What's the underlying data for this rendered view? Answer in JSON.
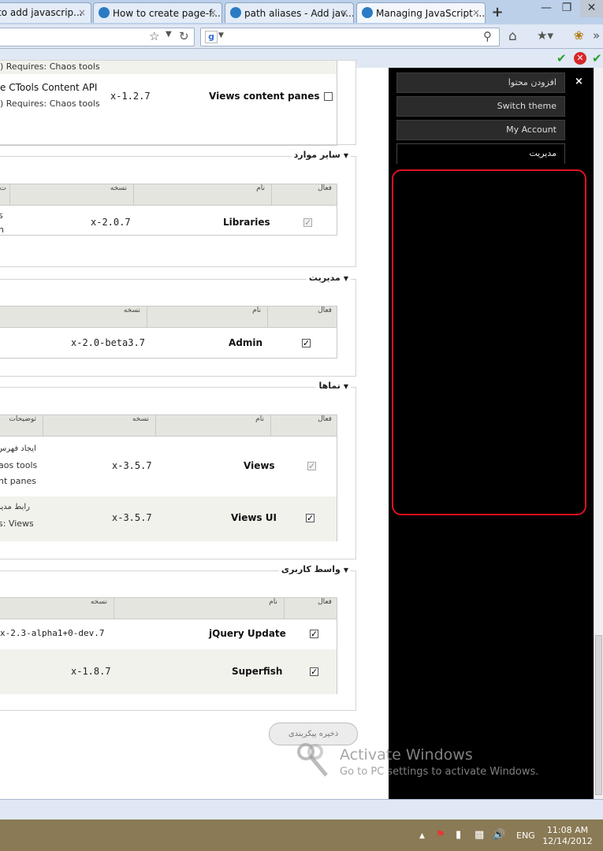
{
  "browser": {
    "tabs": [
      {
        "title": "to add javascrip..."
      },
      {
        "title": "How to create page-f..."
      },
      {
        "title": "path aliases - Add jav..."
      },
      {
        "title": "Managing JavaScript ..."
      }
    ],
    "tab_close": "×",
    "new_tab": "+"
  },
  "page": {
    "top_row": {
      "desc_line1": ") Requires: Chaos tools",
      "desc_line2_a": "e CTools Content API",
      "desc_line3": ") Requires: Chaos tools",
      "version": "x-1.2.7",
      "name": "Views content panes"
    },
    "groups": [
      {
        "legend": "سایر موارد",
        "headers": {
          "enabled": "فعال",
          "name": "نام",
          "version": "نسخه",
          "desc": "ت"
        },
        "rows": [
          {
            "name": "Libraries",
            "version": "x-2.0.7",
            "desc1": "s",
            "desc2": "n"
          }
        ]
      },
      {
        "legend": "مدیریت",
        "headers": {
          "enabled": "فعال",
          "name": "نام",
          "version": "نسخه"
        },
        "rows": [
          {
            "name": "Admin",
            "version": "x-2.0-beta3.7"
          }
        ]
      },
      {
        "legend": "نماها",
        "headers": {
          "enabled": "فعال",
          "name": "نام",
          "version": "نسخه",
          "desc": "توضیحات"
        },
        "rows": [
          {
            "name": "Views",
            "version": "x-3.5.7",
            "desc1": "ایجاد فهرس",
            "desc2": "aos tools",
            "desc3": "nt panes"
          },
          {
            "name": "Views UI",
            "version": "x-3.5.7",
            "desc1": "رابط مدیر",
            "desc2": "s: Views"
          }
        ]
      },
      {
        "legend": "واسط کاربری",
        "headers": {
          "enabled": "فعال",
          "name": "نام",
          "version": "نسخه"
        },
        "rows": [
          {
            "name": "jQuery Update",
            "version": "x-2.3-alpha1+0-dev.7"
          },
          {
            "name": "Superfish",
            "version": "x-1.8.7"
          }
        ]
      }
    ],
    "save_button": "ذخیره پیکربندی"
  },
  "admin_menu": {
    "items": [
      "افزودن محتوا",
      "Switch theme",
      "My Account"
    ],
    "active": "مدیریت",
    "close": "×"
  },
  "watermark": {
    "title": "Activate Windows",
    "subtitle": "Go to PC settings to activate Windows."
  },
  "taskbar": {
    "lang": "ENG",
    "time": "11:08 AM",
    "date": "12/14/2012"
  }
}
